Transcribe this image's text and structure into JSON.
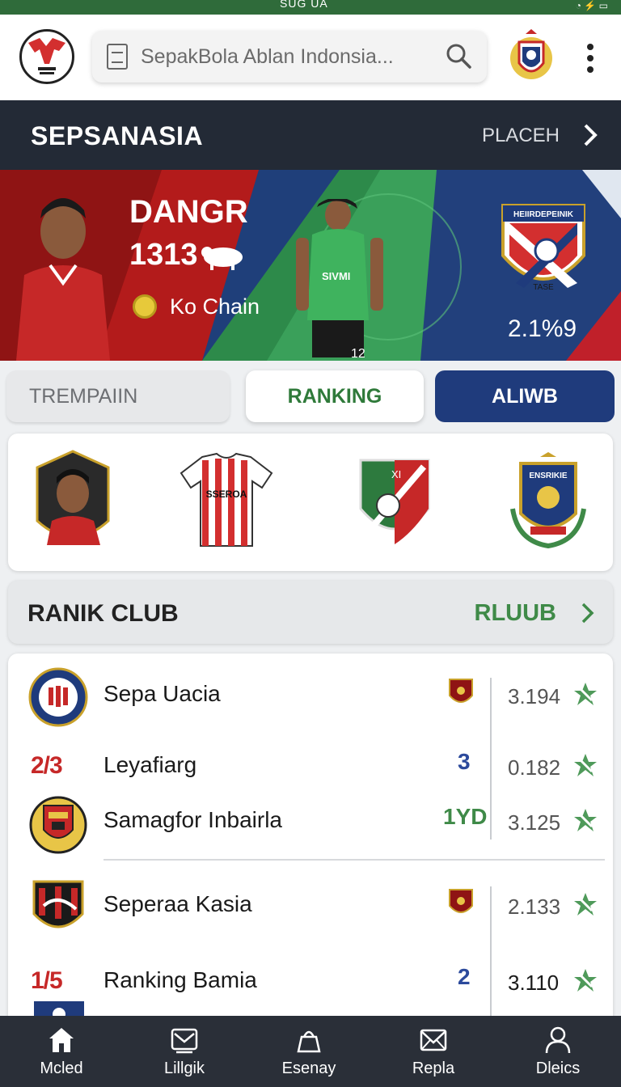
{
  "status_bar": {
    "time": "SUG UA"
  },
  "header": {
    "search_placeholder": "SepakBola Ablan  Indonsia..."
  },
  "section": {
    "title": "SEPSANASIA",
    "link": "PLACEH"
  },
  "hero": {
    "title": "DANGR",
    "number": "1313",
    "subtitle": "Ko Chain",
    "jersey_text": "SIVMI",
    "jersey_number": "12",
    "score": "2.1%9",
    "crest_text": "HEIIRDEPEINIK",
    "crest_sub": "TASE"
  },
  "tabs": [
    {
      "label": "TREMPAIIN"
    },
    {
      "label": "RANKING"
    },
    {
      "label": "ALIWB"
    }
  ],
  "badges": {
    "jersey_text": "SSEROA",
    "shield_text": "XI",
    "crest_text": "ENSRIKIE"
  },
  "ranking": {
    "title": "RANIK CLUB",
    "link": "RLUUB",
    "rows": [
      {
        "rank": "",
        "name": "Sepa Uacia",
        "mark": "",
        "value": "3.194"
      },
      {
        "rank": "2/3",
        "name": "Leyafiarg",
        "mark": "3",
        "value": "0.182"
      },
      {
        "rank": "",
        "name": "Samagfor Inbairla",
        "mark": "1YD",
        "value": "3.125"
      },
      {
        "rank": "",
        "name": "Seperaa Kasia",
        "mark": "",
        "value": "2.133"
      },
      {
        "rank": "1/5",
        "name": "Ranking Bamia",
        "mark": "2",
        "value": "3.110"
      }
    ]
  },
  "nav": [
    {
      "label": "Mcled",
      "icon": "home-icon"
    },
    {
      "label": "Lillgik",
      "icon": "mail-icon"
    },
    {
      "label": "Esenay",
      "icon": "bag-icon"
    },
    {
      "label": "Repla",
      "icon": "envelope-icon"
    },
    {
      "label": "Dleics",
      "icon": "user-icon"
    }
  ],
  "colors": {
    "status_green": "#2f6b3a",
    "dark_bar": "#232a36",
    "accent_green": "#3f8a48",
    "accent_blue": "#1f3b7c",
    "accent_red": "#c62828"
  }
}
